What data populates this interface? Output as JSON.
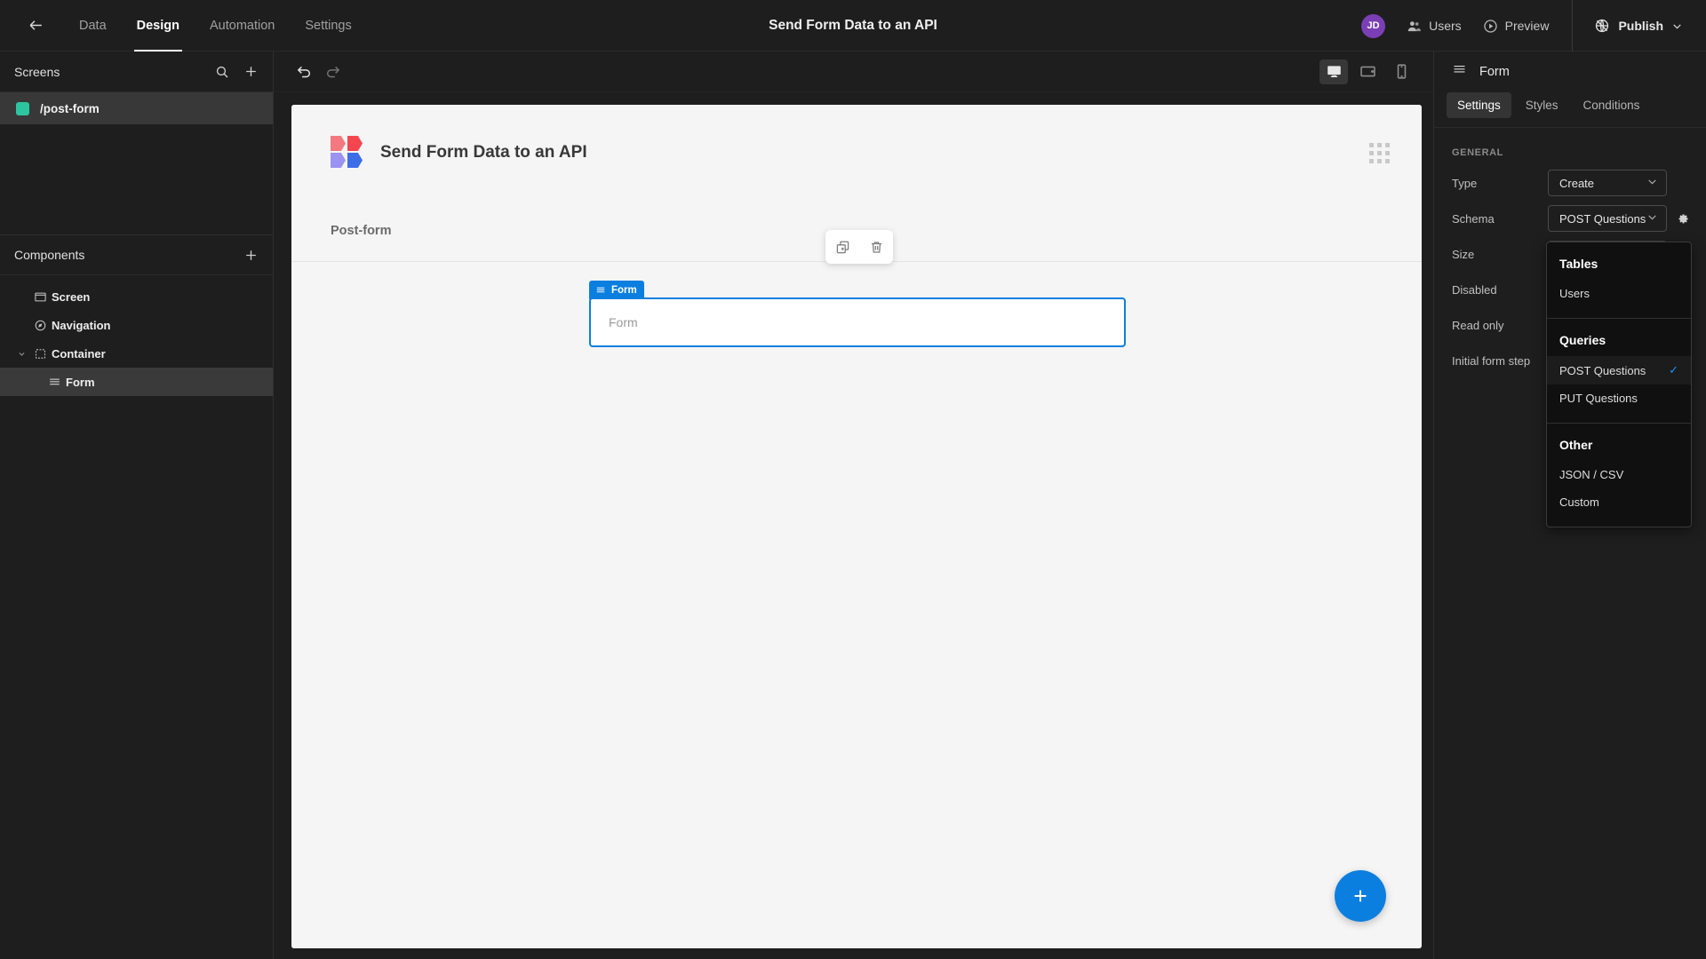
{
  "topbar": {
    "back_icon": "arrow-left-icon",
    "nav": [
      {
        "label": "Data",
        "active": false
      },
      {
        "label": "Design",
        "active": true
      },
      {
        "label": "Automation",
        "active": false
      },
      {
        "label": "Settings",
        "active": false
      }
    ],
    "title": "Send Form Data to an API",
    "avatar_initials": "JD",
    "avatar_color": "#7b3fb5",
    "users_label": "Users",
    "preview_label": "Preview",
    "publish_label": "Publish"
  },
  "sidebar": {
    "screens_title": "Screens",
    "search_icon": "search-icon",
    "add_icon": "plus-icon",
    "screens": [
      {
        "label": "/post-form",
        "color": "#2cc5a0",
        "selected": true
      }
    ],
    "components_title": "Components",
    "components_add_icon": "plus-icon",
    "components": [
      {
        "label": "Screen",
        "icon": "screen-icon",
        "depth": 0,
        "selected": false,
        "caret": false
      },
      {
        "label": "Navigation",
        "icon": "navigation-icon",
        "depth": 0,
        "selected": false,
        "caret": false
      },
      {
        "label": "Container",
        "icon": "container-icon",
        "depth": 0,
        "selected": false,
        "caret": true
      },
      {
        "label": "Form",
        "icon": "form-icon",
        "depth": 1,
        "selected": true,
        "caret": false
      }
    ]
  },
  "canvas": {
    "undo_icon": "undo-icon",
    "redo_icon": "redo-icon",
    "devices": [
      {
        "name": "desktop-icon",
        "active": true
      },
      {
        "name": "tablet-icon",
        "active": false
      },
      {
        "name": "mobile-icon",
        "active": false
      }
    ],
    "page_title": "Send Form Data to an API",
    "page_subtitle": "Post-form",
    "grid_icon": "grid-dots-icon",
    "logo_colors": [
      "#f4787f",
      "#f4464f",
      "#9b93f2",
      "#3d6ee8"
    ],
    "float_toolbar": [
      {
        "name": "duplicate-icon"
      },
      {
        "name": "delete-icon"
      }
    ],
    "selected_component": {
      "tag_label": "Form",
      "placeholder": "Form",
      "accent": "#0b7fe0"
    },
    "fab_icon": "plus-icon",
    "fab_color": "#0b7fe0"
  },
  "rightpanel": {
    "header_icon": "form-icon",
    "header_label": "Form",
    "tabs": [
      {
        "label": "Settings",
        "active": true
      },
      {
        "label": "Styles",
        "active": false
      },
      {
        "label": "Conditions",
        "active": false
      }
    ],
    "section_label": "GENERAL",
    "fields": {
      "type_label": "Type",
      "type_value": "Create",
      "schema_label": "Schema",
      "schema_value": "POST Questions",
      "schema_gear_icon": "gear-icon",
      "size_label": "Size",
      "disabled_label": "Disabled",
      "readonly_label": "Read only",
      "initial_step_label": "Initial form step"
    }
  },
  "dropdown": {
    "groups": [
      {
        "heading": "Tables",
        "items": [
          {
            "label": "Users",
            "checked": false
          }
        ]
      },
      {
        "heading": "Queries",
        "items": [
          {
            "label": "POST Questions",
            "checked": true
          },
          {
            "label": "PUT Questions",
            "checked": false
          }
        ]
      },
      {
        "heading": "Other",
        "items": [
          {
            "label": "JSON / CSV",
            "checked": false
          },
          {
            "label": "Custom",
            "checked": false
          }
        ]
      }
    ],
    "check_glyph": "✓"
  }
}
